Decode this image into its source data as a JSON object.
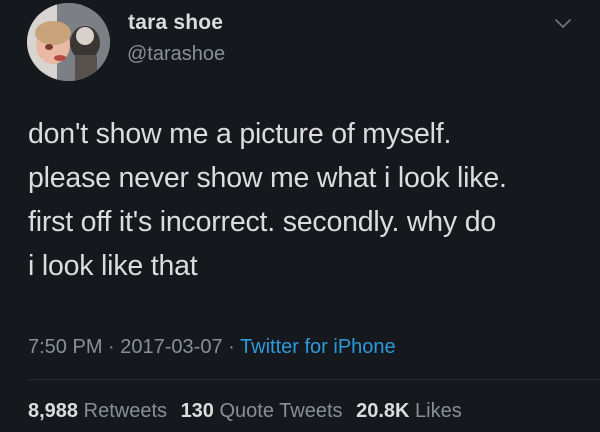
{
  "tweet": {
    "display_name": "tara shoe",
    "handle": "@tarashoe",
    "text_lines": [
      "don't show me a picture of myself.",
      "please never show me what i look like.",
      "first off it's incorrect. secondly. why do",
      "i look like that"
    ],
    "time": "7:50 PM",
    "separator": "·",
    "date": "2017-03-07",
    "source": "Twitter for iPhone",
    "stats": {
      "retweets_count": "8,988",
      "retweets_label": "Retweets",
      "quote_tweets_count": "130",
      "quote_tweets_label": "Quote Tweets",
      "likes_count": "20.8K",
      "likes_label": "Likes"
    }
  },
  "icons": {
    "avatar": "profile-photo",
    "menu": "chevron-down-icon"
  },
  "colors": {
    "background": "#15181c",
    "text_primary": "#dcdcdc",
    "text_secondary": "#8a8f95",
    "link": "#2e99dc",
    "divider": "#2a2f35"
  }
}
